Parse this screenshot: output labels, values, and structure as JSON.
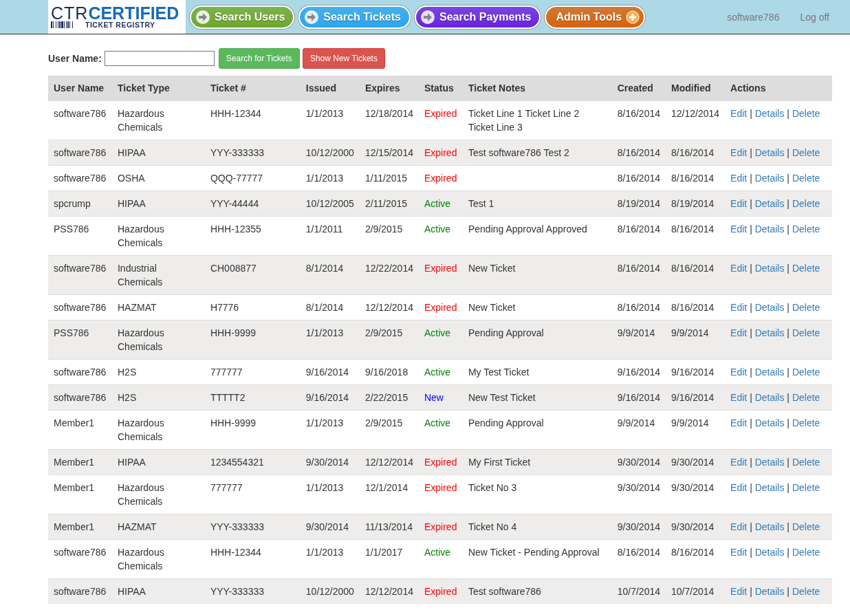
{
  "header": {
    "logo": {
      "ctr": "CTR",
      "certified": "CERTIFIED",
      "registry": "TICKET REGISTRY"
    },
    "nav": [
      {
        "label": "Search Users",
        "kind": "arrow",
        "color": "#6fa82a"
      },
      {
        "label": "Search Tickets",
        "kind": "arrow",
        "color": "#2aa6ee"
      },
      {
        "label": "Search Payments",
        "kind": "arrow",
        "color": "#6a22e0"
      },
      {
        "label": "Admin Tools",
        "kind": "plus",
        "color": "#d8620a"
      }
    ],
    "user": "software786",
    "logoff": "Log off"
  },
  "search": {
    "label": "User Name:",
    "buttons": [
      {
        "label": "Search for Tickets",
        "kind": "success"
      },
      {
        "label": "Show New Tickets",
        "kind": "danger"
      }
    ]
  },
  "table": {
    "columns": [
      "User Name",
      "Ticket Type",
      "Ticket #",
      "Issued",
      "Expires",
      "Status",
      "Ticket Notes",
      "Created",
      "Modified",
      "Actions"
    ],
    "rows": [
      {
        "user": "software786",
        "type": "Hazardous Chemicals",
        "ticket": "HHH-12344",
        "issued": "1/1/2013",
        "expires": "12/18/2014",
        "status": {
          "text": "Expired",
          "color": "#ff0000"
        },
        "notes": "Ticket Line 1 Ticket Line 2 Ticket Line 3",
        "created": "8/16/2014",
        "modified": "12/12/2014",
        "actions": [
          "Edit",
          "Details",
          "Delete"
        ],
        "separator": "|"
      },
      {
        "user": "software786",
        "type": "HIPAA",
        "ticket": "YYY-333333",
        "issued": "10/12/2000",
        "expires": "12/15/2014",
        "status": {
          "text": "Expired",
          "color": "#ff0000"
        },
        "notes": "Test software786 Test 2",
        "created": "8/16/2014",
        "modified": "8/16/2014",
        "actions": [
          "Edit",
          "Details",
          "Delete"
        ],
        "separator": "|"
      },
      {
        "user": "software786",
        "type": "OSHA",
        "ticket": "QQQ-77777",
        "issued": "1/1/2013",
        "expires": "1/11/2015",
        "status": {
          "text": "Expired",
          "color": "#ff0000"
        },
        "created": "8/16/2014",
        "modified": "8/16/2014",
        "actions": [
          "Edit",
          "Details",
          "Delete"
        ],
        "separator": "|"
      },
      {
        "user": "spcrump",
        "type": "HIPAA",
        "ticket": "YYY-44444",
        "issued": "10/12/2005",
        "expires": "2/11/2015",
        "status": {
          "text": "Active",
          "color": "#008000"
        },
        "notes": "Test 1",
        "created": "8/19/2014",
        "modified": "8/19/2014",
        "actions": [
          "Edit",
          "Details",
          "Delete"
        ],
        "separator": "|"
      },
      {
        "user": "PSS786",
        "type": "Hazardous Chemicals",
        "ticket": "HHH-12355",
        "issued": "1/1/2011",
        "expires": "2/9/2015",
        "status": {
          "text": "Active",
          "color": "#008000"
        },
        "notes": "Pending Approval Approved",
        "created": "8/16/2014",
        "modified": "8/16/2014",
        "actions": [
          "Edit",
          "Details",
          "Delete"
        ],
        "separator": "|"
      },
      {
        "user": "software786",
        "type": "Industrial Chemicals",
        "ticket": "CH008877",
        "issued": "8/1/2014",
        "expires": "12/22/2014",
        "status": {
          "text": "Expired",
          "color": "#ff0000"
        },
        "notes": "New Ticket",
        "created": "8/16/2014",
        "modified": "8/16/2014",
        "actions": [
          "Edit",
          "Details",
          "Delete"
        ],
        "separator": "|"
      },
      {
        "user": "software786",
        "type": "HAZMAT",
        "ticket": "H7776",
        "issued": "8/1/2014",
        "expires": "12/12/2014",
        "status": {
          "text": "Expired",
          "color": "#ff0000"
        },
        "notes": "New Ticket",
        "created": "8/16/2014",
        "modified": "8/16/2014",
        "actions": [
          "Edit",
          "Details",
          "Delete"
        ],
        "separator": "|"
      },
      {
        "user": "PSS786",
        "type": "Hazardous Chemicals",
        "ticket": "HHH-9999",
        "issued": "1/1/2013",
        "expires": "2/9/2015",
        "status": {
          "text": "Active",
          "color": "#008000"
        },
        "notes": "Pending Approval",
        "created": "9/9/2014",
        "modified": "9/9/2014",
        "actions": [
          "Edit",
          "Details",
          "Delete"
        ],
        "separator": "|"
      },
      {
        "user": "software786",
        "type": "H2S",
        "ticket": "777777",
        "issued": "9/16/2014",
        "expires": "9/16/2018",
        "status": {
          "text": "Active",
          "color": "#008000"
        },
        "notes": "My Test Ticket",
        "created": "9/16/2014",
        "modified": "9/16/2014",
        "actions": [
          "Edit",
          "Details",
          "Delete"
        ],
        "separator": "|"
      },
      {
        "user": "software786",
        "type": "H2S",
        "ticket": "TTTTT2",
        "issued": "9/16/2014",
        "expires": "2/22/2015",
        "status": {
          "text": "New",
          "color": "#0000ff"
        },
        "notes": "New Test Ticket",
        "created": "9/16/2014",
        "modified": "9/16/2014",
        "actions": [
          "Edit",
          "Details",
          "Delete"
        ],
        "separator": "|"
      },
      {
        "user": "Member1",
        "type": "Hazardous Chemicals",
        "ticket": "HHH-9999",
        "issued": "1/1/2013",
        "expires": "2/9/2015",
        "status": {
          "text": "Active",
          "color": "#008000"
        },
        "notes": "Pending Approval",
        "created": "9/9/2014",
        "modified": "9/9/2014",
        "actions": [
          "Edit",
          "Details",
          "Delete"
        ],
        "separator": "|"
      },
      {
        "user": "Member1",
        "type": "HIPAA",
        "ticket": "1234554321",
        "issued": "9/30/2014",
        "expires": "12/12/2014",
        "status": {
          "text": "Expired",
          "color": "#ff0000"
        },
        "notes": "My First Ticket",
        "created": "9/30/2014",
        "modified": "9/30/2014",
        "actions": [
          "Edit",
          "Details",
          "Delete"
        ],
        "separator": "|"
      },
      {
        "user": "Member1",
        "type": "Hazardous Chemicals",
        "ticket": "777777",
        "issued": "1/1/2013",
        "expires": "12/1/2014",
        "status": {
          "text": "Expired",
          "color": "#ff0000"
        },
        "notes": "Ticket No 3",
        "created": "9/30/2014",
        "modified": "9/30/2014",
        "actions": [
          "Edit",
          "Details",
          "Delete"
        ],
        "separator": "|"
      },
      {
        "user": "Member1",
        "type": "HAZMAT",
        "ticket": "YYY-333333",
        "issued": "9/30/2014",
        "expires": "11/13/2014",
        "status": {
          "text": "Expired",
          "color": "#ff0000"
        },
        "notes": "Ticket No 4",
        "created": "9/30/2014",
        "modified": "9/30/2014",
        "actions": [
          "Edit",
          "Details",
          "Delete"
        ],
        "separator": "|"
      },
      {
        "user": "software786",
        "type": "Hazardous Chemicals",
        "ticket": "HHH-12344",
        "issued": "1/1/2013",
        "expires": "1/1/2017",
        "status": {
          "text": "Active",
          "color": "#008000"
        },
        "notes": "New Ticket - Pending Approval",
        "created": "8/16/2014",
        "modified": "8/16/2014",
        "actions": [
          "Edit",
          "Details",
          "Delete"
        ],
        "separator": "|"
      },
      {
        "user": "software786",
        "type": "HIPAA",
        "ticket": "YYY-333333",
        "issued": "10/12/2000",
        "expires": "12/12/2014",
        "status": {
          "text": "Expired",
          "color": "#ff0000"
        },
        "notes": "Test software786",
        "created": "10/7/2014",
        "modified": "10/7/2014",
        "actions": [
          "Edit",
          "Details",
          "Delete"
        ],
        "separator": "|"
      }
    ]
  }
}
